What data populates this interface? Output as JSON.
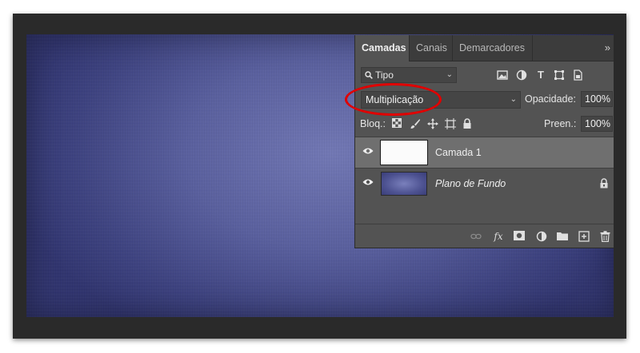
{
  "panel": {
    "tabs": [
      {
        "label": "Camadas",
        "active": true
      },
      {
        "label": "Canais",
        "active": false
      },
      {
        "label": "Demarcadores",
        "active": false
      }
    ],
    "collapse_glyph": "»",
    "filter": {
      "label": "Tipo",
      "icon": "search-icon"
    },
    "filter_icons": [
      "image-filter-icon",
      "adjustment-filter-icon",
      "type-filter-icon",
      "shape-filter-icon",
      "smart-object-filter-icon"
    ],
    "blend_mode": "Multiplicação",
    "opacity_label": "Opacidade:",
    "opacity_value": "100%",
    "lock_label": "Bloq.:",
    "lock_icons": [
      "lock-transparent-icon",
      "lock-paint-icon",
      "lock-position-icon",
      "lock-artboard-icon",
      "lock-all-icon"
    ],
    "fill_label": "Preen.:",
    "fill_value": "100%",
    "layers": [
      {
        "name": "Camada 1",
        "selected": true,
        "visible": true,
        "locked": false
      },
      {
        "name": "Plano de Fundo",
        "selected": false,
        "visible": true,
        "locked": true
      }
    ],
    "bottom_icons": [
      "link-icon",
      "fx-icon",
      "mask-icon",
      "adjustment-layer-icon",
      "folder-icon",
      "new-layer-icon",
      "trash-icon"
    ]
  },
  "colors": {
    "highlight": "#e00000",
    "canvas": "#5a609e",
    "panel": "#535353"
  }
}
